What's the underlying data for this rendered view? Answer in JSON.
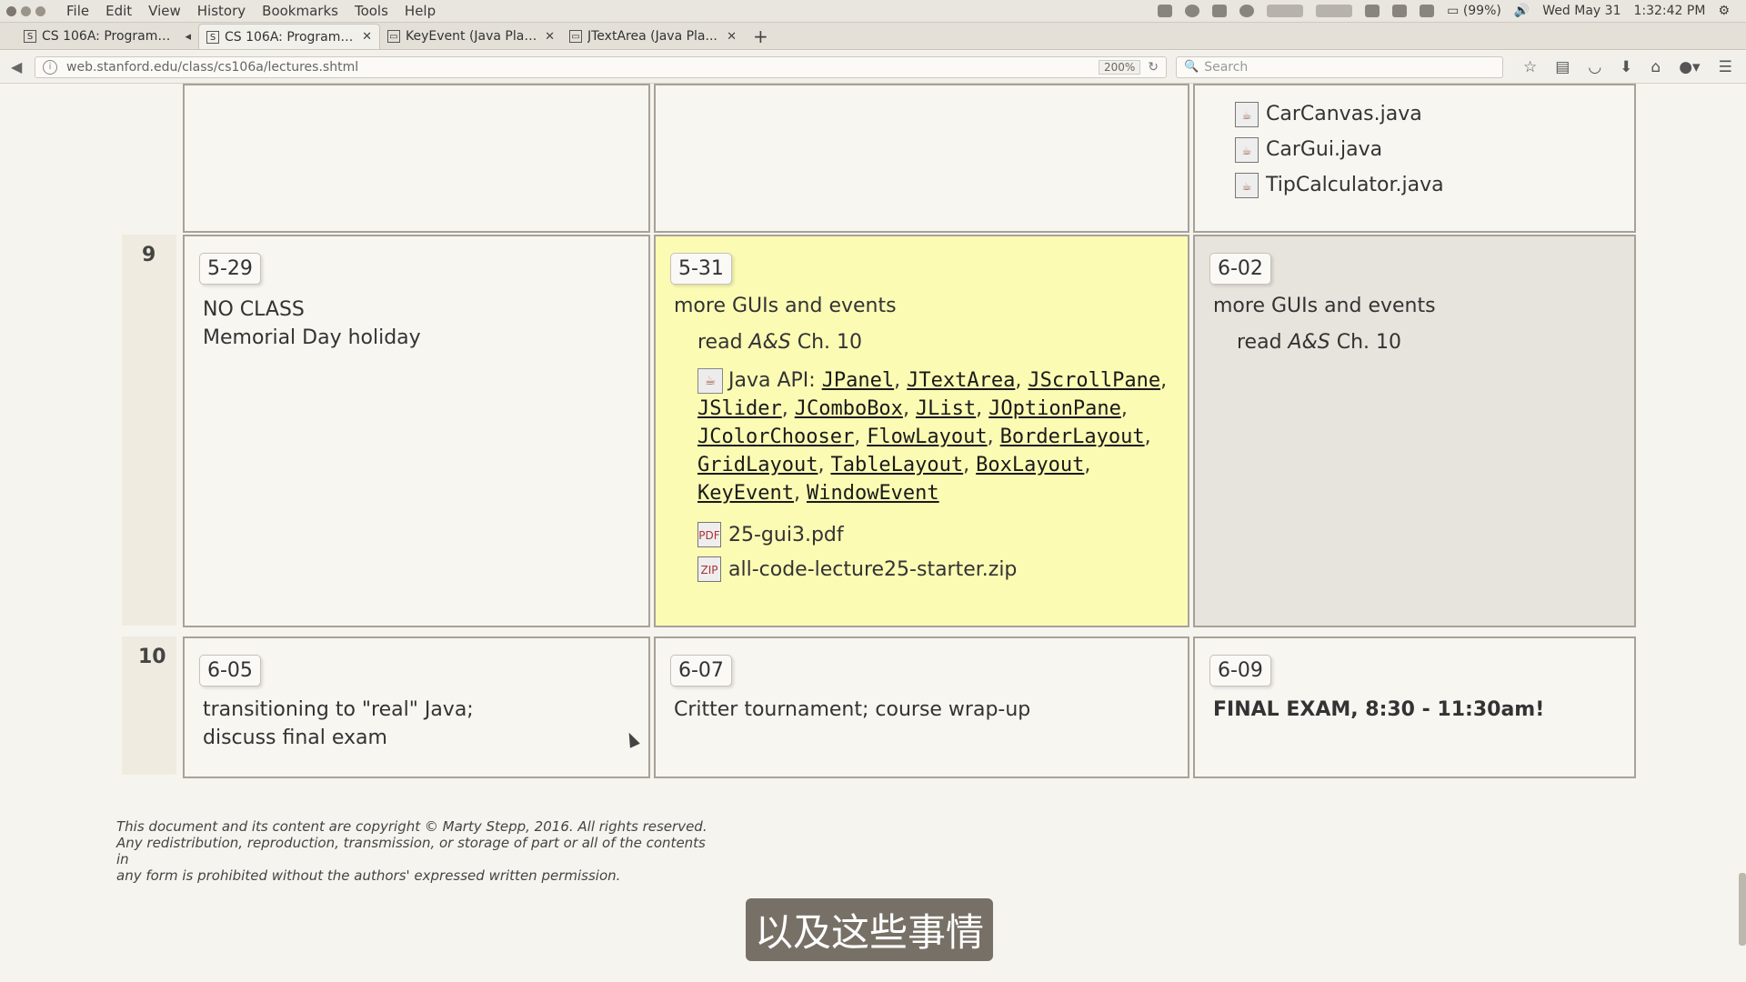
{
  "os": {
    "menus": [
      "File",
      "Edit",
      "View",
      "History",
      "Bookmarks",
      "Tools",
      "Help"
    ],
    "battery": "(99%)",
    "date": "Wed May 31",
    "time": "1:32:42 PM"
  },
  "tabs": [
    {
      "label": "CS 106A: Programm...",
      "favicon": "S"
    },
    {
      "label": "CS 106A: Programm...",
      "favicon": "S"
    },
    {
      "label": "KeyEvent (Java Plat...",
      "favicon": "doc-icon"
    },
    {
      "label": "JTextArea (Java Pla...",
      "favicon": "doc-icon"
    }
  ],
  "nav": {
    "url": "web.stanford.edu/class/cs106a/lectures.shtml",
    "zoom": "200%",
    "search_placeholder": "Search"
  },
  "top_row": {
    "files": [
      "CarCanvas.java",
      "CarGui.java",
      "TipCalculator.java"
    ]
  },
  "week9": {
    "num": "9",
    "mon": {
      "date": "5-29",
      "line1": "NO CLASS",
      "line2": "Memorial Day holiday"
    },
    "wed": {
      "date": "5-31",
      "title": "more GUIs and events",
      "read_prefix": "read ",
      "read_book": "A&S",
      "read_suffix": " Ch. 10",
      "api_label": "Java API: ",
      "api_links": [
        "JPanel",
        "JTextArea",
        "JScrollPane",
        "JSlider",
        "JComboBox",
        "JList",
        "JOptionPane",
        "JColorChooser",
        "FlowLayout",
        "BorderLayout",
        "GridLayout",
        "TableLayout",
        "BoxLayout",
        "KeyEvent",
        "WindowEvent"
      ],
      "files": [
        "25-gui3.pdf",
        "all-code-lecture25-starter.zip"
      ]
    },
    "fri": {
      "date": "6-02",
      "title": "more GUIs and events",
      "read_prefix": "read ",
      "read_book": "A&S",
      "read_suffix": " Ch. 10"
    }
  },
  "week10": {
    "num": "10",
    "mon": {
      "date": "6-05",
      "line1": "transitioning to \"real\" Java;",
      "line2": "discuss final exam"
    },
    "wed": {
      "date": "6-07",
      "title": "Critter tournament; course wrap-up"
    },
    "fri": {
      "date": "6-09",
      "title": "FINAL EXAM, 8:30 - 11:30am!"
    }
  },
  "copyright": {
    "line1": "This document and its content are copyright © Marty Stepp, 2016. All rights reserved.",
    "line2": "Any redistribution, reproduction, transmission, or storage of part or all of the contents in",
    "line3": "any form is prohibited without the authors' expressed written permission."
  },
  "subtitle": "以及这些事情"
}
